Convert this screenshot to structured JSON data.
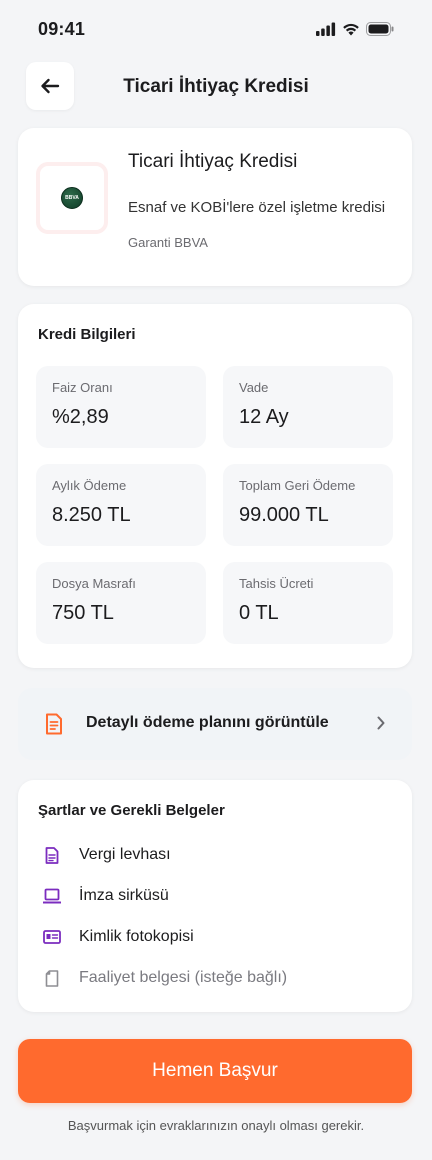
{
  "status_bar": {
    "time": "09:41"
  },
  "header": {
    "title": "Ticari İhtiyaç Kredisi"
  },
  "product": {
    "name": "Ticari İhtiyaç Kredisi",
    "description": "Esnaf ve KOBİ'lere özel işletme kredisi",
    "bank": "Garanti BBVA",
    "logo_text": "BBVA"
  },
  "credit_info": {
    "title": "Kredi Bilgileri",
    "items": [
      {
        "label": "Faiz Oranı",
        "value": "%2,89"
      },
      {
        "label": "Vade",
        "value": "12 Ay"
      },
      {
        "label": "Aylık Ödeme",
        "value": "8.250 TL"
      },
      {
        "label": "Toplam Geri Ödeme",
        "value": "99.000 TL"
      },
      {
        "label": "Dosya Masrafı",
        "value": "750 TL"
      },
      {
        "label": "Tahsis Ücreti",
        "value": "0 TL"
      }
    ]
  },
  "payment_plan": {
    "label": "Detaylı ödeme planını görüntüle"
  },
  "requirements": {
    "title": "Şartlar ve Gerekli Belgeler",
    "items": [
      {
        "label": "Vergi levhası",
        "icon": "document-icon"
      },
      {
        "label": "İmza sirküsü",
        "icon": "laptop-icon"
      },
      {
        "label": "Kimlik fotokopisi",
        "icon": "id-card-icon"
      },
      {
        "label": "Faaliyet belgesi (isteğe bağlı)",
        "icon": "blank-document-icon"
      }
    ]
  },
  "cta": {
    "label": "Hemen Başvur"
  },
  "footnote": "Başvurmak için evraklarınızın onaylı olması gerekir.",
  "colors": {
    "accent": "#ff6a2e",
    "doc_icon": "#7b2cbf",
    "background": "#f4f5f7"
  }
}
